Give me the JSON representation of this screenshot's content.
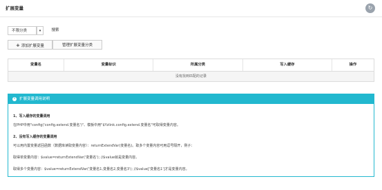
{
  "header": {
    "title": "扩展变量"
  },
  "toolbar": {
    "filter_value": "不限分类",
    "search_label": "搜索",
    "add_label": "添加扩展变量",
    "manage_label": "管理扩展变量分类"
  },
  "table": {
    "headers": [
      "变量名",
      "变量标识",
      "所属分类",
      "写入缓存",
      "操作"
    ],
    "empty_text": "没有找到匹配的记录"
  },
  "panel": {
    "title": "扩展变量调用说明",
    "lines": [
      "1、写入缓存的变量调用",
      "在PHP中用\"config('config.extend.变量名')\"、模板中用\"$Yzlink.config.extend.变量名\"可取得变量内容。",
      "2、没有写入缓存的变量调用",
      "可以用内置变量返回函数（数据库读取变量内容）：returnExtendVar(变量名)。取多个变量内容可用逗号隔开，例子：",
      "取得单变量内容：$value=returnExtendVar('变量名');  //$value就是变量内容。",
      "取得多个变量内容：$value=returnExtendVar('变量名1,变量名2,变量名3');  //$value['变量名1']才是变量内容。"
    ]
  }
}
